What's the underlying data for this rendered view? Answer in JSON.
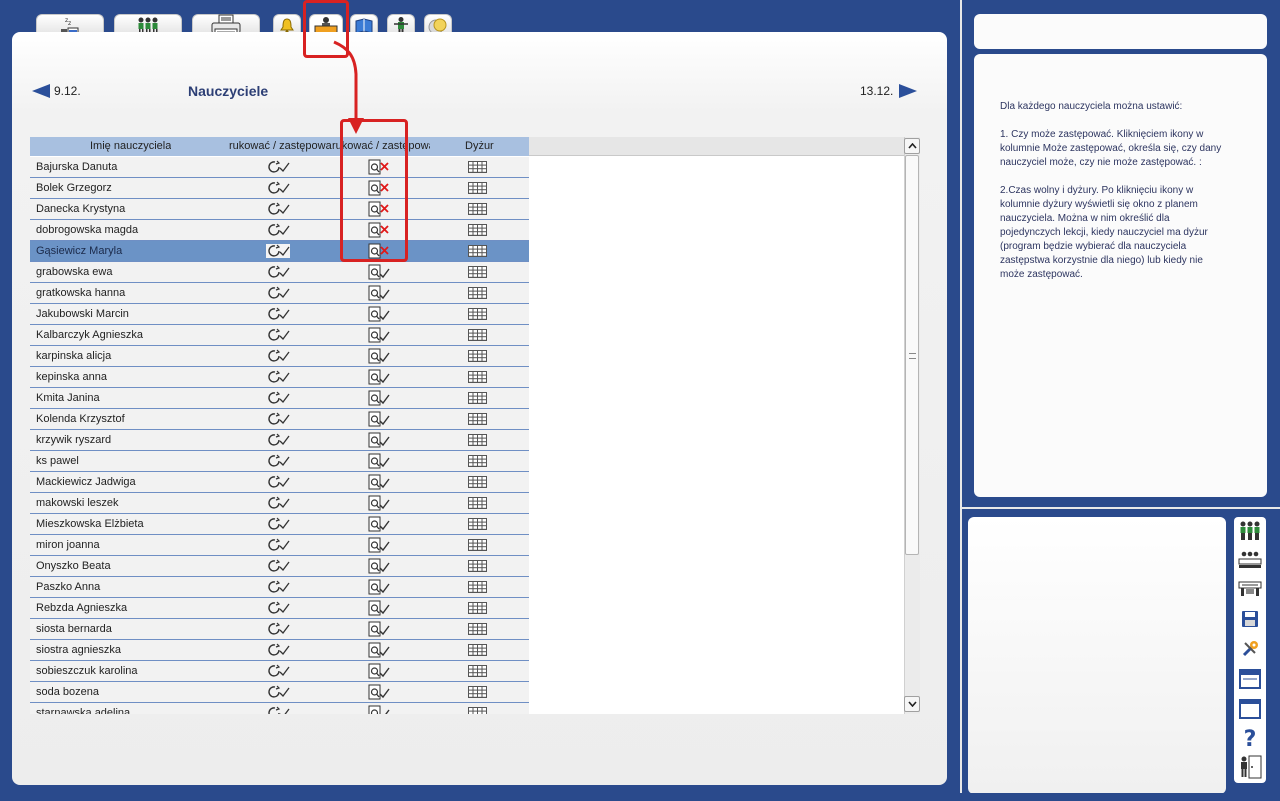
{
  "tabs": [
    {
      "name": "tab-sleep",
      "icon": "sleep-icon"
    },
    {
      "name": "tab-people",
      "icon": "people-icon"
    },
    {
      "name": "tab-print",
      "icon": "printer-icon"
    },
    {
      "name": "tab-bell",
      "icon": "bell-icon"
    },
    {
      "name": "tab-teacher-desk",
      "icon": "teacher-desk-icon"
    },
    {
      "name": "tab-book",
      "icon": "book-icon"
    },
    {
      "name": "tab-person",
      "icon": "person-icon"
    },
    {
      "name": "tab-coins",
      "icon": "coins-icon"
    }
  ],
  "nav": {
    "prev_label": "9.12.",
    "next_label": "13.12."
  },
  "page_title": "Nauczyciele",
  "table": {
    "headers": {
      "name": "Imię nauczyciela",
      "col1": "rukować / zastępowa",
      "col2": "rukować / zastępowa",
      "col3": "Dyżur"
    },
    "rows": [
      {
        "name": "Bajurska Danuta",
        "can_substitute": false
      },
      {
        "name": "Bolek Grzegorz",
        "can_substitute": false
      },
      {
        "name": "Danecka Krystyna",
        "can_substitute": false
      },
      {
        "name": "dobrogowska magda",
        "can_substitute": false
      },
      {
        "name": "Gąsiewicz Maryla",
        "can_substitute": false,
        "selected": true
      },
      {
        "name": "grabowska ewa",
        "can_substitute": true
      },
      {
        "name": "gratkowska hanna",
        "can_substitute": true
      },
      {
        "name": "Jakubowski Marcin",
        "can_substitute": true
      },
      {
        "name": "Kalbarczyk Agnieszka",
        "can_substitute": true
      },
      {
        "name": "karpinska alicja",
        "can_substitute": true
      },
      {
        "name": "kepinska anna",
        "can_substitute": true
      },
      {
        "name": "Kmita Janina",
        "can_substitute": true
      },
      {
        "name": "Kolenda Krzysztof",
        "can_substitute": true
      },
      {
        "name": "krzywik ryszard",
        "can_substitute": true
      },
      {
        "name": "ks pawel",
        "can_substitute": true
      },
      {
        "name": "Mackiewicz Jadwiga",
        "can_substitute": true
      },
      {
        "name": "makowski leszek",
        "can_substitute": true
      },
      {
        "name": "Mieszkowska Elżbieta",
        "can_substitute": true
      },
      {
        "name": "miron joanna",
        "can_substitute": true
      },
      {
        "name": "Onyszko Beata",
        "can_substitute": true
      },
      {
        "name": "Paszko Anna",
        "can_substitute": true
      },
      {
        "name": "Rebzda Agnieszka",
        "can_substitute": true
      },
      {
        "name": "siosta bernarda",
        "can_substitute": true
      },
      {
        "name": "siostra agnieszka",
        "can_substitute": true
      },
      {
        "name": "sobieszczuk karolina",
        "can_substitute": true
      },
      {
        "name": "soda bozena",
        "can_substitute": true
      },
      {
        "name": "starnawska adelina",
        "can_substitute": true
      }
    ]
  },
  "help": {
    "text": "Dla każdego nauczyciela można ustawić:\n\n1. Czy może zastępować. Kliknięciem ikony w kolumnie Może zastępować, określa się, czy dany nauczyciel może, czy nie może zastępować. :\n\n2.Czas wolny i dyżury. Po kliknięciu ikony w kolumnie dyżury wyświetli się okno z planem nauczyciela. Można w nim określić dla pojedynczych lekcji, kiedy nauczyciel ma dyżur (program będzie wybierać dla nauczyciela zastępstwa korzystnie dla niego) lub kiedy nie może zastępować."
  },
  "toolbar": [
    {
      "name": "teachers-tool",
      "icon": "teachers-icon"
    },
    {
      "name": "classes-tool",
      "icon": "classes-icon"
    },
    {
      "name": "rooms-tool",
      "icon": "rooms-icon"
    },
    {
      "name": "save-tool",
      "icon": "save-icon"
    },
    {
      "name": "settings-tool",
      "icon": "tools-icon"
    },
    {
      "name": "window-tool",
      "icon": "window-icon"
    },
    {
      "name": "blank-window-tool",
      "icon": "blank-window-icon"
    },
    {
      "name": "help-tool",
      "icon": "help-icon",
      "label": "?"
    },
    {
      "name": "exit-tool",
      "icon": "exit-icon"
    }
  ],
  "colors": {
    "background": "#2a4a8c",
    "header_blue": "#a8c0e0",
    "row_border": "#6f8fc4",
    "selected_row": "#6b93c6",
    "annotation_red": "#d82222",
    "title": "#2d3f75"
  }
}
